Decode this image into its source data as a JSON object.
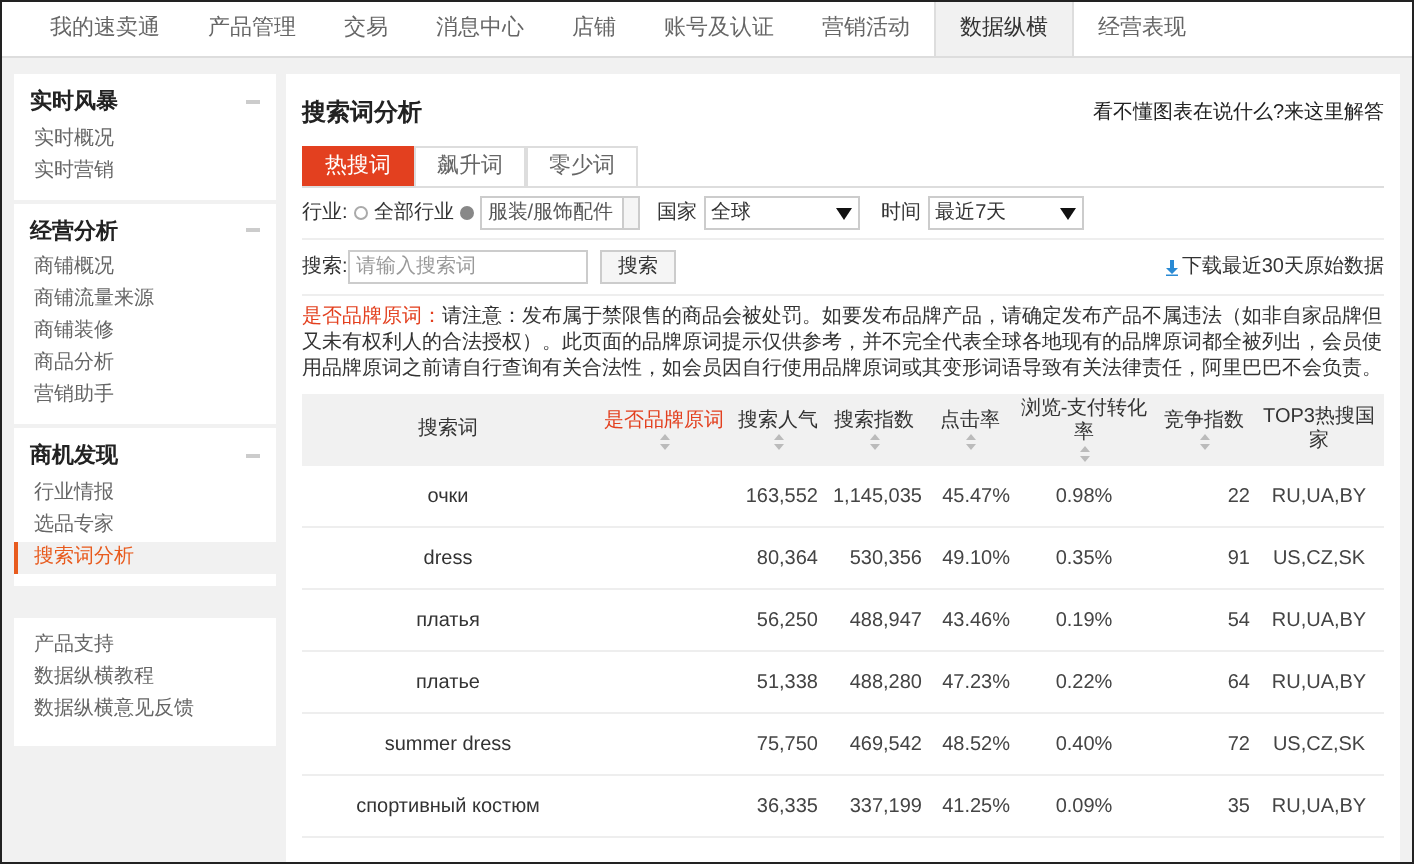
{
  "nav": [
    {
      "label": "我的速卖通",
      "selected": false
    },
    {
      "label": "产品管理",
      "selected": false
    },
    {
      "label": "交易",
      "selected": false
    },
    {
      "label": "消息中心",
      "selected": false
    },
    {
      "label": "店铺",
      "selected": false
    },
    {
      "label": "账号及认证",
      "selected": false
    },
    {
      "label": "营销活动",
      "selected": false
    },
    {
      "label": "数据纵横",
      "selected": true
    },
    {
      "label": "经营表现",
      "selected": false
    }
  ],
  "sidebar": [
    {
      "title": "实时风暴",
      "collapsible": true,
      "items": [
        {
          "label": "实时概况",
          "selected": false
        },
        {
          "label": "实时营销",
          "selected": false
        }
      ]
    },
    {
      "title": "经营分析",
      "collapsible": true,
      "items": [
        {
          "label": "商铺概况",
          "selected": false
        },
        {
          "label": "商铺流量来源",
          "selected": false
        },
        {
          "label": "商铺装修",
          "selected": false
        },
        {
          "label": "商品分析",
          "selected": false
        },
        {
          "label": "营销助手",
          "selected": false
        }
      ]
    },
    {
      "title": "商机发现",
      "collapsible": true,
      "items": [
        {
          "label": "行业情报",
          "selected": false
        },
        {
          "label": "选品专家",
          "selected": false
        },
        {
          "label": "搜索词分析",
          "selected": true
        }
      ]
    },
    {
      "items": [
        {
          "label": "产品支持",
          "selected": false
        },
        {
          "label": "数据纵横教程",
          "selected": false
        },
        {
          "label": "数据纵横意见反馈",
          "selected": false
        }
      ]
    }
  ],
  "page_title": "搜索词分析",
  "help_link": "看不懂图表在说什么?来这里解答",
  "tabs": [
    {
      "label": "热搜词",
      "selected": true
    },
    {
      "label": "飙升词",
      "selected": false
    },
    {
      "label": "零少词",
      "selected": false
    }
  ],
  "filters": {
    "industry_label": "行业:",
    "industry_options": [
      {
        "label": "全部行业",
        "selected": false
      },
      {
        "kind": "select",
        "value": "服装/服饰配件",
        "selected": true
      }
    ],
    "country_label": "国家",
    "country": "全球",
    "time_label": "时间",
    "time": "最近7天"
  },
  "search": {
    "label": "搜索:",
    "placeholder": "请输入搜索词",
    "button": "搜索"
  },
  "download_link": "下载最近30天原始数据",
  "notice": {
    "label": "是否品牌原词：",
    "text": "请注意：发布属于禁限售的商品会被处罚。如要发布品牌产品，请确定发布产品不属违法（如非自家品牌但又未有权利人的合法授权）。此页面的品牌原词提示仅供参考，并不完全代表全球各地现有的品牌原词都全被列出，会员使用品牌原词之前请自行查询有关合法性，如会员因自行使用品牌原词或其变形词语导致有关法律责任，阿里巴巴不会负责。"
  },
  "table": {
    "columns": [
      {
        "label": "搜索词",
        "sortable": false,
        "highlight": false
      },
      {
        "label": "是否品牌原词",
        "sortable": true,
        "highlight": true
      },
      {
        "label": "搜索人气",
        "sortable": true,
        "highlight": false
      },
      {
        "label": "搜索指数",
        "sortable": true,
        "highlight": false
      },
      {
        "label": "点击率",
        "sortable": true,
        "highlight": false
      },
      {
        "label": "浏览-支付转化率",
        "sortable": true,
        "highlight": false
      },
      {
        "label": "竞争指数",
        "sortable": true,
        "highlight": false
      },
      {
        "label": "TOP3热搜国家",
        "sortable": false,
        "highlight": false
      }
    ],
    "rows": [
      [
        "очки",
        "",
        "163,552",
        "1,145,035",
        "45.47%",
        "0.98%",
        "22",
        "RU,UA,BY"
      ],
      [
        "dress",
        "",
        "80,364",
        "530,356",
        "49.10%",
        "0.35%",
        "91",
        "US,CZ,SK"
      ],
      [
        "платья",
        "",
        "56,250",
        "488,947",
        "43.46%",
        "0.19%",
        "54",
        "RU,UA,BY"
      ],
      [
        "платье",
        "",
        "51,338",
        "488,280",
        "47.23%",
        "0.22%",
        "64",
        "RU,UA,BY"
      ],
      [
        "summer dress",
        "",
        "75,750",
        "469,542",
        "48.52%",
        "0.40%",
        "72",
        "US,CZ,SK"
      ],
      [
        "спортивный костюм",
        "",
        "36,335",
        "337,199",
        "41.25%",
        "0.09%",
        "35",
        "RU,UA,BY"
      ]
    ]
  }
}
